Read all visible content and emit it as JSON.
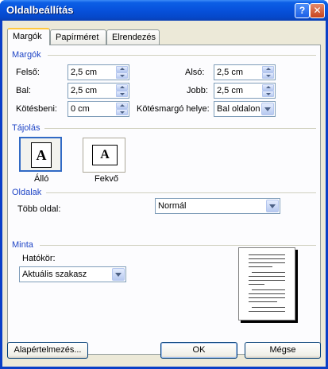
{
  "window": {
    "title": "Oldalbeállítás",
    "help_glyph": "?",
    "close_glyph": "✕"
  },
  "tabs": [
    {
      "label": "Margók"
    },
    {
      "label": "Papírméret"
    },
    {
      "label": "Elrendezés"
    }
  ],
  "margins": {
    "section_title": "Margók",
    "top_label": "Felső:",
    "top_value": "2,5 cm",
    "bottom_label": "Alsó:",
    "bottom_value": "2,5 cm",
    "left_label": "Bal:",
    "left_value": "2,5 cm",
    "right_label": "Jobb:",
    "right_value": "2,5 cm",
    "gutter_label": "Kötésbeni:",
    "gutter_value": "0 cm",
    "gutter_pos_label": "Kötésmargó helye:",
    "gutter_pos_value": "Bal oldalon"
  },
  "orientation": {
    "section_title": "Tájolás",
    "portrait_label": "Álló",
    "landscape_label": "Fekvő",
    "page_glyph": "A",
    "selected": "portrait"
  },
  "pages": {
    "section_title": "Oldalak",
    "multiple_label": "Több oldal:",
    "multiple_value": "Normál"
  },
  "preview": {
    "section_title": "Minta",
    "apply_label": "Hatókör:",
    "apply_value": "Aktuális szakasz"
  },
  "buttons": {
    "default_label": "Alapértelmezés...",
    "ok_label": "OK",
    "cancel_label": "Mégse"
  }
}
